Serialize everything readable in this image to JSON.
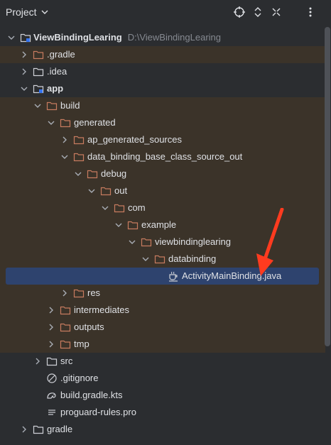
{
  "header": {
    "title": "Project",
    "icons": [
      "chevron-down-icon",
      "locate-icon",
      "expand-collapse-icon",
      "close-icon",
      "more-icon"
    ]
  },
  "tree": {
    "root": {
      "label": "ViewBindingLearing",
      "path": "D:\\ViewBindingLearing"
    },
    "gradle_hidden": {
      "label": ".gradle"
    },
    "idea": {
      "label": ".idea"
    },
    "app": {
      "label": "app"
    },
    "build": {
      "label": "build"
    },
    "generated": {
      "label": "generated"
    },
    "ap_generated": {
      "label": "ap_generated_sources"
    },
    "data_binding": {
      "label": "data_binding_base_class_source_out"
    },
    "debug": {
      "label": "debug"
    },
    "out": {
      "label": "out"
    },
    "com": {
      "label": "com"
    },
    "example": {
      "label": "example"
    },
    "viewbindinglearing": {
      "label": "viewbindinglearing"
    },
    "databinding": {
      "label": "databinding"
    },
    "activity_binding": {
      "label": "ActivityMainBinding.java"
    },
    "res": {
      "label": "res"
    },
    "intermediates": {
      "label": "intermediates"
    },
    "outputs": {
      "label": "outputs"
    },
    "tmp": {
      "label": "tmp"
    },
    "src": {
      "label": "src"
    },
    "gitignore": {
      "label": ".gitignore"
    },
    "build_gradle": {
      "label": "build.gradle.kts"
    },
    "proguard": {
      "label": "proguard-rules.pro"
    },
    "gradle": {
      "label": "gradle"
    }
  },
  "colors": {
    "background": "#2b2d30",
    "build_tint": "#3b3329",
    "selection": "#2e436e",
    "folder": "#c77b5f",
    "annotation_arrow": "#ff3b1f"
  }
}
